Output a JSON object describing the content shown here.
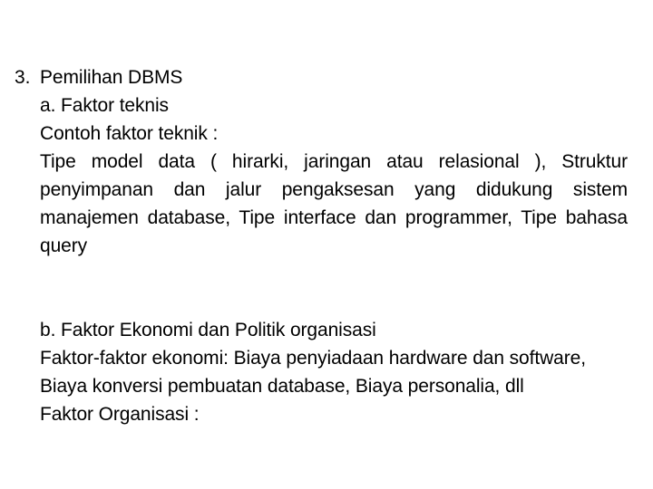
{
  "slide": {
    "background_color": "#ffffff",
    "text_color": "#000000",
    "section_3": {
      "marker": "3.",
      "title": "Pemilihan DBMS",
      "sub_a_heading": "a. Faktor teknis",
      "sub_a_intro": "Contoh faktor teknik :",
      "sub_a_paragraph": "Tipe model data ( hirarki, jaringan atau relasional ), Struktur penyimpanan dan jalur pengaksesan yang didukung sistem manajemen database, Tipe interface dan programmer, Tipe bahasa query",
      "sub_b_heading": "b. Faktor Ekonomi dan Politik organisasi",
      "sub_b_line_1": "Faktor-faktor ekonomi: Biaya penyiadaan hardware dan software,",
      "sub_b_line_2": "Biaya konversi pembuatan database, Biaya personalia, dll",
      "sub_b_line_3": "Faktor Organisasi :"
    }
  }
}
